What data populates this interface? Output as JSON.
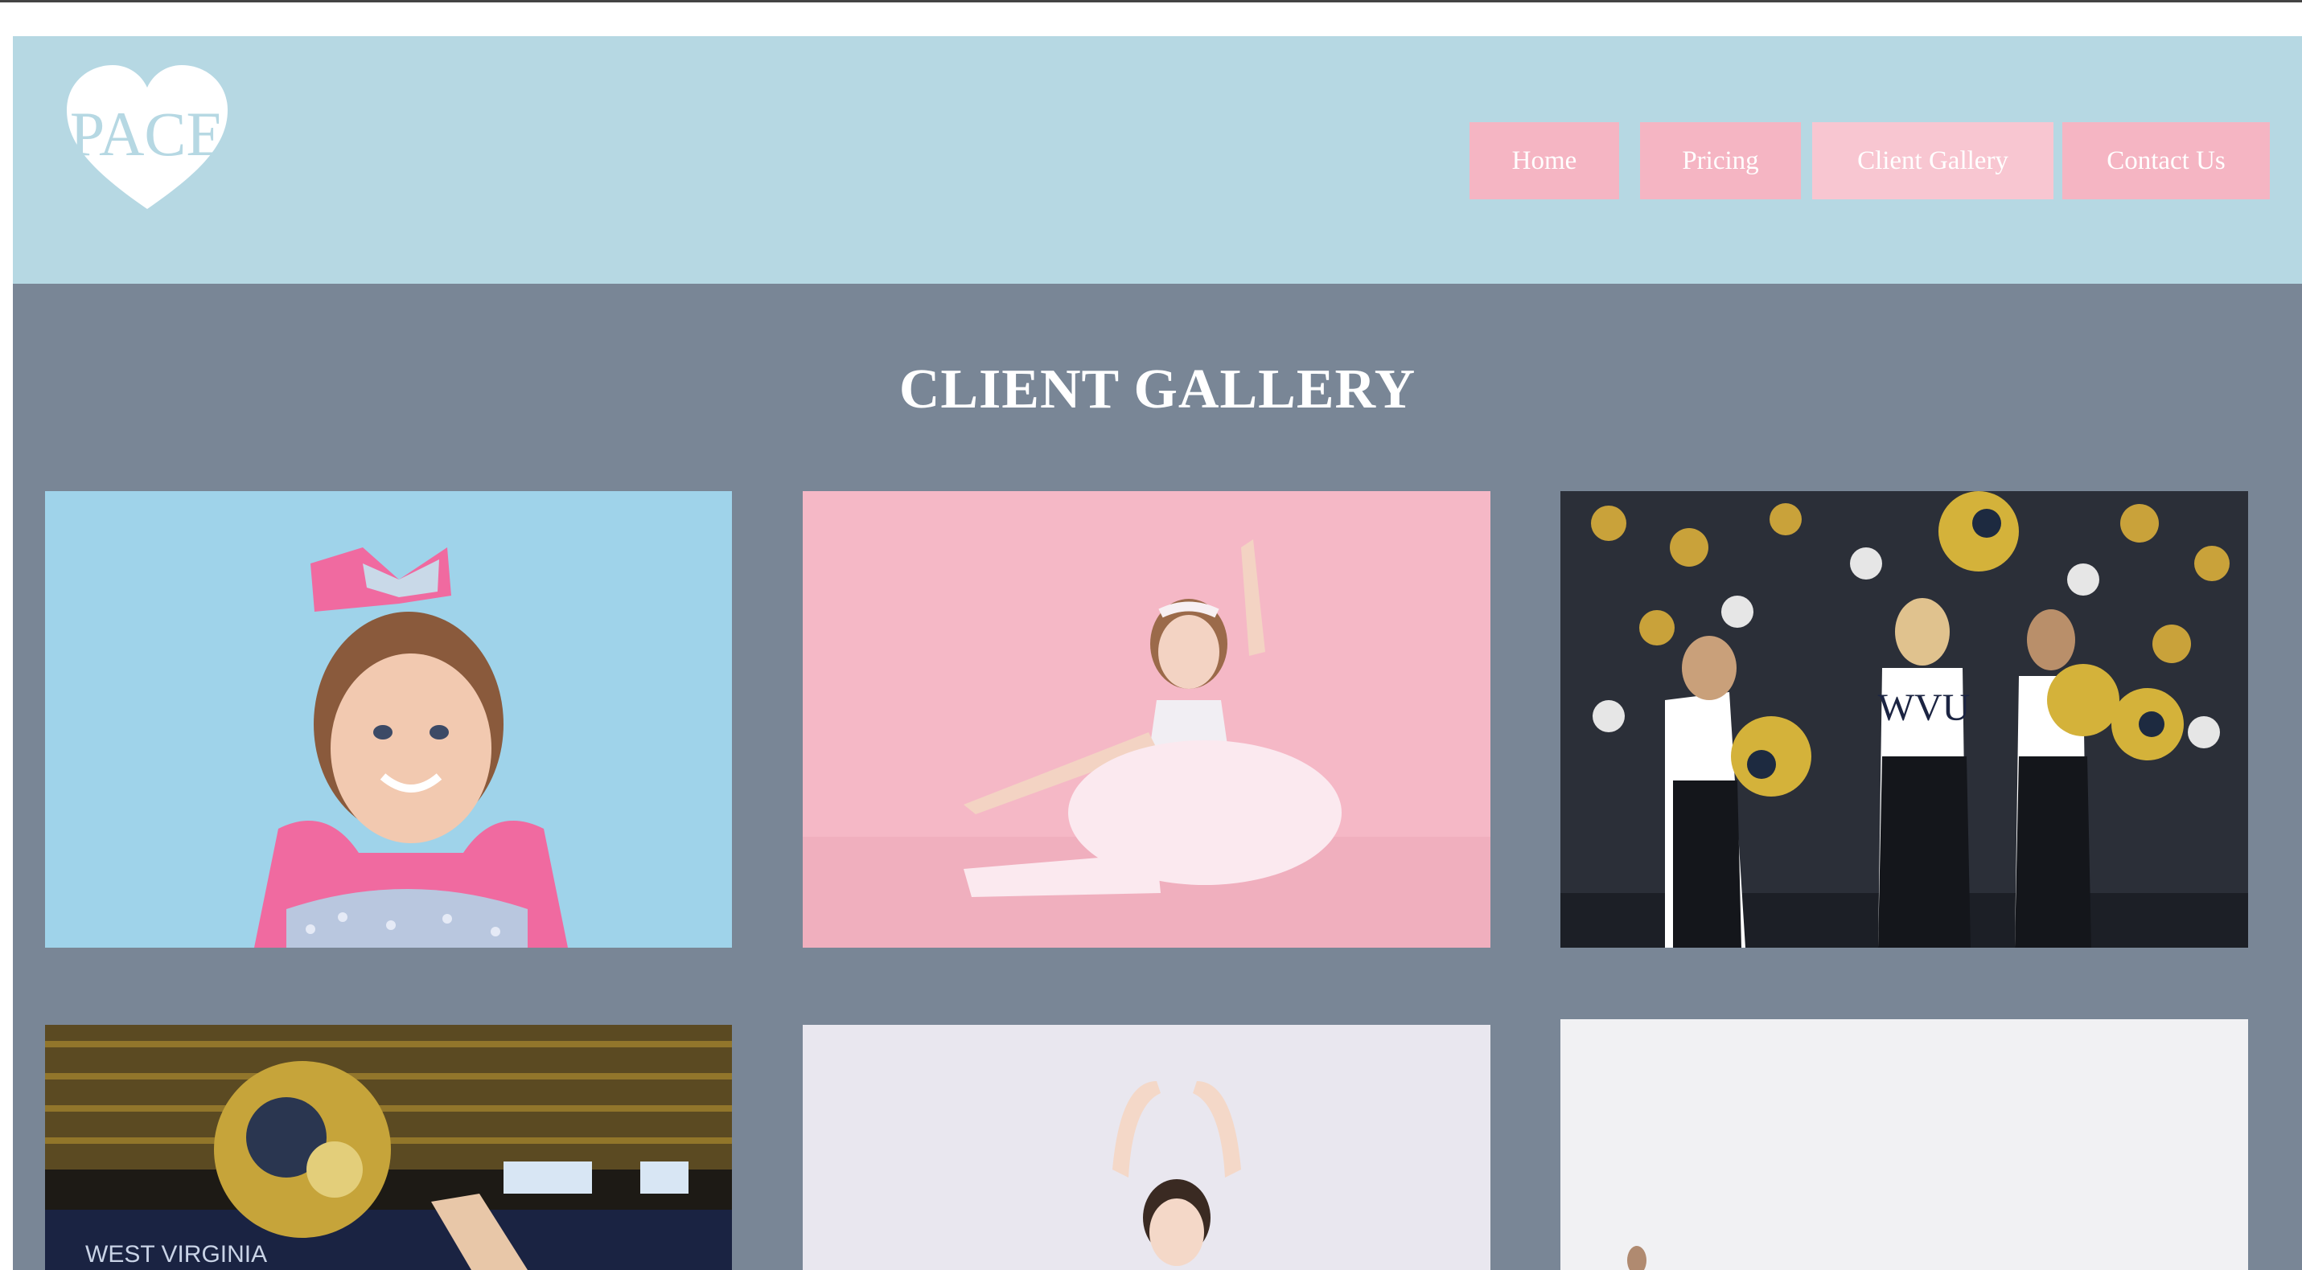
{
  "colors": {
    "header_bg": "#b6d8e3",
    "content_bg": "#798696",
    "nav_button_bg": "#f5b5c3",
    "nav_button_active_bg": "#f8c6d1",
    "text": "#ffffff"
  },
  "brand": {
    "logo_text": "PACE",
    "logo_icon": "heart-logo-icon"
  },
  "nav": {
    "items": [
      {
        "label": "Home"
      },
      {
        "label": "Pricing"
      },
      {
        "label": "Client Gallery",
        "active": true
      },
      {
        "label": "Contact Us"
      }
    ]
  },
  "gallery": {
    "title": "CLIENT GALLERY",
    "photos": [
      {
        "subject": "girl-with-pink-bow-blue-backdrop"
      },
      {
        "subject": "ballerina-pink-backdrop"
      },
      {
        "subject": "wvu-cheerleaders-arena"
      },
      {
        "subject": "cheerleader-pompom-arena"
      },
      {
        "subject": "ballerina-arms-up-white-backdrop"
      },
      {
        "subject": "dancer-white-backdrop"
      }
    ]
  }
}
